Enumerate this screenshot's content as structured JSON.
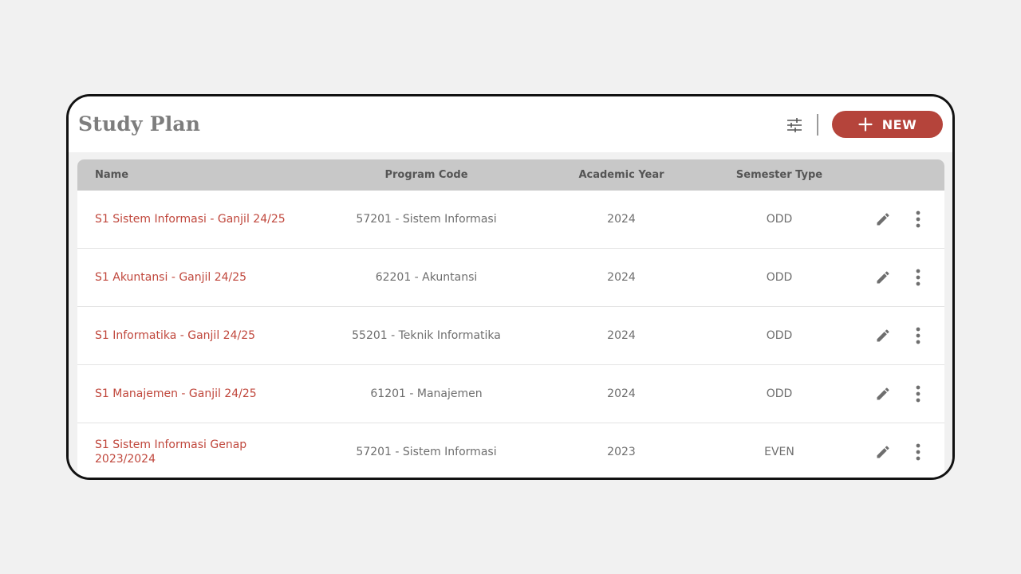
{
  "page": {
    "title": "Study Plan",
    "new_button_label": "NEW"
  },
  "icons": {
    "filter": "sliders-icon",
    "add": "plus-icon",
    "edit": "pencil-icon",
    "more": "more-vertical-icon"
  },
  "colors": {
    "accent": "#b5443b",
    "link": "#c0473c",
    "header_bg": "#c8c8c8",
    "border": "#111111"
  },
  "table": {
    "columns": [
      "Name",
      "Program Code",
      "Academic Year",
      "Semester Type"
    ],
    "rows": [
      {
        "name": "S1 Sistem Informasi - Ganjil 24/25",
        "program_code": "57201 - Sistem Informasi",
        "academic_year": "2024",
        "semester_type": "ODD"
      },
      {
        "name": "S1 Akuntansi - Ganjil 24/25",
        "program_code": "62201 - Akuntansi",
        "academic_year": "2024",
        "semester_type": "ODD"
      },
      {
        "name": "S1 Informatika - Ganjil 24/25",
        "program_code": "55201 - Teknik Informatika",
        "academic_year": "2024",
        "semester_type": "ODD"
      },
      {
        "name": "S1 Manajemen - Ganjil 24/25",
        "program_code": "61201 - Manajemen",
        "academic_year": "2024",
        "semester_type": "ODD"
      },
      {
        "name": "S1 Sistem Informasi Genap 2023/2024",
        "program_code": "57201 - Sistem Informasi",
        "academic_year": "2023",
        "semester_type": "EVEN"
      }
    ]
  }
}
